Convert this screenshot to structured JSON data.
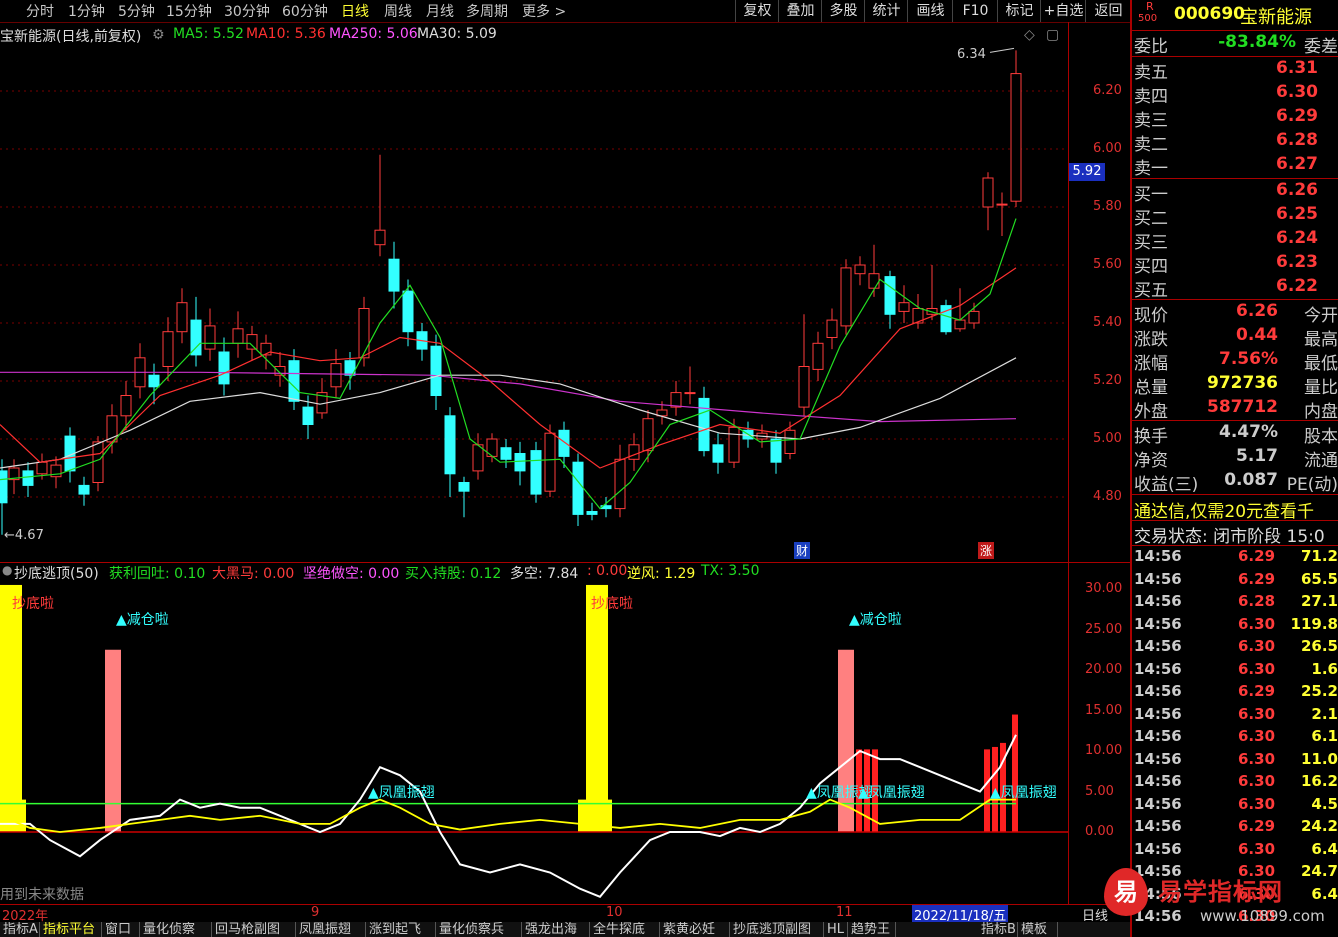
{
  "toolbar": {
    "periods": [
      "分时",
      "1分钟",
      "5分钟",
      "15分钟",
      "30分钟",
      "60分钟",
      "日线",
      "周线",
      "月线",
      "多周期",
      "更多 >"
    ],
    "active_period": "日线",
    "buttons": [
      "复权",
      "叠加",
      "多股",
      "统计",
      "画线",
      "F10",
      "标记",
      "+自选",
      "返回"
    ]
  },
  "main_header": {
    "stock": "宝新能源(日线,前复权)",
    "ma5": "MA5: 5.52",
    "ma10": "MA10: 5.36",
    "ma250": "MA250: 5.06",
    "ma30": "MA30: 5.09"
  },
  "main_axis": {
    "labels": [
      "6.20",
      "6.00",
      "5.80",
      "5.60",
      "5.40",
      "5.20",
      "5.00",
      "4.80"
    ],
    "current_price": "5.92"
  },
  "price_annotations": {
    "high": "6.34",
    "low": "4.67",
    "marker_cai": "财",
    "marker_zhang": "涨"
  },
  "indicator_header": {
    "name": "抄底逃顶(50)",
    "items": [
      {
        "text": "获利回吐: 0.10",
        "color": "#22dd22"
      },
      {
        "text": "大黑马: 0.00",
        "color": "#ff3b3b"
      },
      {
        "text": "坚绝做空: 0.00",
        "color": "#ff55ff"
      },
      {
        "text": "买入持股: 0.12",
        "color": "#22dd22"
      },
      {
        "text": "多空: 7.84",
        "color": "#dddddd"
      },
      {
        "text": ": 0.00",
        "color": "#ff3b3b"
      },
      {
        "text": "逆风: 1.29",
        "color": "#ffff33"
      },
      {
        "text": "TX: 3.50",
        "color": "#22dd22"
      }
    ]
  },
  "indicator_axis": {
    "labels": [
      "30.00",
      "25.00",
      "20.00",
      "15.00",
      "10.00",
      "5.00",
      "0.00"
    ]
  },
  "indicator_labels": {
    "chaodi": "抄底啦",
    "jiancang": "▲减仓啦",
    "fenghuang": "▲凤凰振翅",
    "future_note": "用到未来数据"
  },
  "date_bar": {
    "year": "2022年",
    "m9": "9",
    "m10": "10",
    "m11": "11",
    "cursor_date": "2022/11/18/五",
    "period": "日线"
  },
  "tabs": [
    "指标A",
    "指标平台",
    "窗口",
    "量化侦察",
    "回马枪副图",
    "凤凰振翅",
    "涨到起飞",
    "量化侦察兵",
    "强龙出海",
    "全牛探底",
    "紫黄必妊",
    "抄底逃顶副图",
    "HL",
    "趋势王",
    "指标B",
    "模板"
  ],
  "active_tab": "指标平台",
  "quote": {
    "code": "000690",
    "name": "宝新能源",
    "r_label": "R",
    "r_num": "500",
    "weibi_label": "委比",
    "weibi_value": "-83.84%",
    "weicha_label": "委差",
    "asks": [
      {
        "label": "卖五",
        "price": "6.31"
      },
      {
        "label": "卖四",
        "price": "6.30"
      },
      {
        "label": "卖三",
        "price": "6.29"
      },
      {
        "label": "卖二",
        "price": "6.28"
      },
      {
        "label": "卖一",
        "price": "6.27"
      }
    ],
    "bids": [
      {
        "label": "买一",
        "price": "6.26"
      },
      {
        "label": "买二",
        "price": "6.25"
      },
      {
        "label": "买三",
        "price": "6.24"
      },
      {
        "label": "买四",
        "price": "6.23"
      },
      {
        "label": "买五",
        "price": "6.22"
      }
    ],
    "stats": [
      {
        "k": "现价",
        "v": "6.26",
        "k2": "今开",
        "color": "#ff3b3b"
      },
      {
        "k": "涨跌",
        "v": "0.44",
        "k2": "最高",
        "color": "#ff3b3b"
      },
      {
        "k": "涨幅",
        "v": "7.56%",
        "k2": "最低",
        "color": "#ff3b3b"
      },
      {
        "k": "总量",
        "v": "972736",
        "k2": "量比",
        "color": "#ffff33"
      },
      {
        "k": "外盘",
        "v": "587712",
        "k2": "内盘",
        "color": "#ff3b3b"
      }
    ],
    "stats2": [
      {
        "k": "换手",
        "v": "4.47%",
        "k2": "股本",
        "color": "#cccccc"
      },
      {
        "k": "净资",
        "v": "5.17",
        "k2": "流通",
        "color": "#cccccc"
      },
      {
        "k": "收益(三)",
        "v": "0.087",
        "k2": "PE(动)",
        "color": "#cccccc"
      }
    ],
    "ad": "通达信,仅需20元查看千",
    "trade_status": "交易状态: 闭市阶段 15:0",
    "ticks": [
      {
        "t": "14:56",
        "p": "6.29",
        "q": "71.2"
      },
      {
        "t": "14:56",
        "p": "6.29",
        "q": "65.5"
      },
      {
        "t": "14:56",
        "p": "6.28",
        "q": "27.1"
      },
      {
        "t": "14:56",
        "p": "6.30",
        "q": "119.8"
      },
      {
        "t": "14:56",
        "p": "6.30",
        "q": "26.5"
      },
      {
        "t": "14:56",
        "p": "6.30",
        "q": "1.6"
      },
      {
        "t": "14:56",
        "p": "6.29",
        "q": "25.2"
      },
      {
        "t": "14:56",
        "p": "6.30",
        "q": "2.1"
      },
      {
        "t": "14:56",
        "p": "6.30",
        "q": "6.1"
      },
      {
        "t": "14:56",
        "p": "6.30",
        "q": "11.0"
      },
      {
        "t": "14:56",
        "p": "6.30",
        "q": "16.2"
      },
      {
        "t": "14:56",
        "p": "6.30",
        "q": "4.5"
      },
      {
        "t": "14:56",
        "p": "6.29",
        "q": "24.2"
      },
      {
        "t": "14:56",
        "p": "6.30",
        "q": "6.4"
      },
      {
        "t": "14:56",
        "p": "6.30",
        "q": "24.7"
      },
      {
        "t": "14:56",
        "p": "6.30",
        "q": "6.4"
      },
      {
        "t": "14:56",
        "p": "6.30",
        "q": ""
      }
    ]
  },
  "watermark": {
    "brand": "易学指标网",
    "url": "www.10899.com",
    "logo_char": "易"
  },
  "colors": {
    "up": "#ff3b3b",
    "down": "#33ffff",
    "ma5": "#22dd22",
    "ma10": "#ff3030",
    "ma30": "#dddddd",
    "ma250": "#cc33cc"
  }
}
